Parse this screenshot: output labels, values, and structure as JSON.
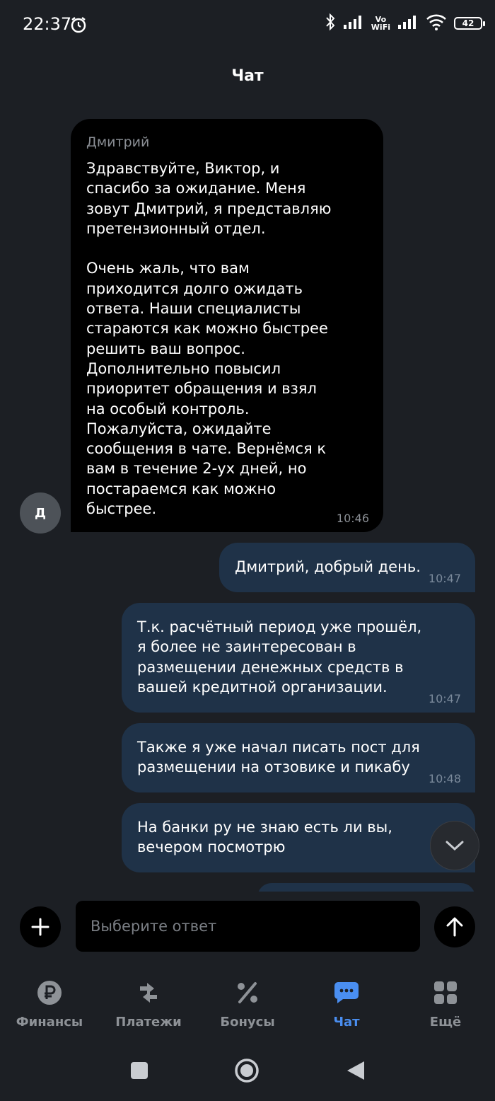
{
  "status_bar": {
    "time": "22:37",
    "battery": "42",
    "vowifi_top": "Vo",
    "vowifi_bottom": "WiFi"
  },
  "header": {
    "title": "Чат"
  },
  "chat": {
    "incoming": {
      "avatar_letter": "Д",
      "sender": "Дмитрий",
      "text": "Здравствуйте, Виктор, и\nспасибо за ожидание. Меня\nзовут Дмитрий, я представляю\nпретензионный отдел.\n\nОчень жаль, что вам\nприходится долго ожидать\nответа. Наши специалисты\nстараются как можно быстрее\nрешить ваш вопрос.\nДополнительно повысил\nприоритет обращения и взял\nна особый контроль.\nПожалуйста, ожидайте\nсообщения в чате. Вернёмся к\nвам в течение 2-ух дней, но\nпостараемся как можно\nбыстрее.",
      "time": "10:46"
    },
    "outgoing": [
      {
        "text": "Дмитрий, добрый день.",
        "time": "10:47"
      },
      {
        "text": "Т.к. расчётный период уже прошёл,\nя более не заинтересован в\nразмещении денежных средств в\nвашей кредитной организации.",
        "time": "10:47"
      },
      {
        "text": "Также я уже начал писать пост для\nразмещении на отзовике и пикабу",
        "time": "10:48"
      },
      {
        "text": "На банки ру не знаю есть ли вы,\nвечером посмотрю",
        "time": ""
      }
    ]
  },
  "composer": {
    "placeholder": "Выберите ответ"
  },
  "tabs": [
    {
      "label": "Финансы",
      "icon": "ruble-icon"
    },
    {
      "label": "Платежи",
      "icon": "transfer-icon"
    },
    {
      "label": "Бонусы",
      "icon": "percent-icon"
    },
    {
      "label": "Чат",
      "icon": "chat-icon",
      "active": true
    },
    {
      "label": "Ещё",
      "icon": "grid-icon"
    }
  ],
  "colors": {
    "background": "#1c1f24",
    "incoming_bubble": "#000000",
    "outgoing_bubble": "#1f3248",
    "accent": "#4a8ef0"
  }
}
